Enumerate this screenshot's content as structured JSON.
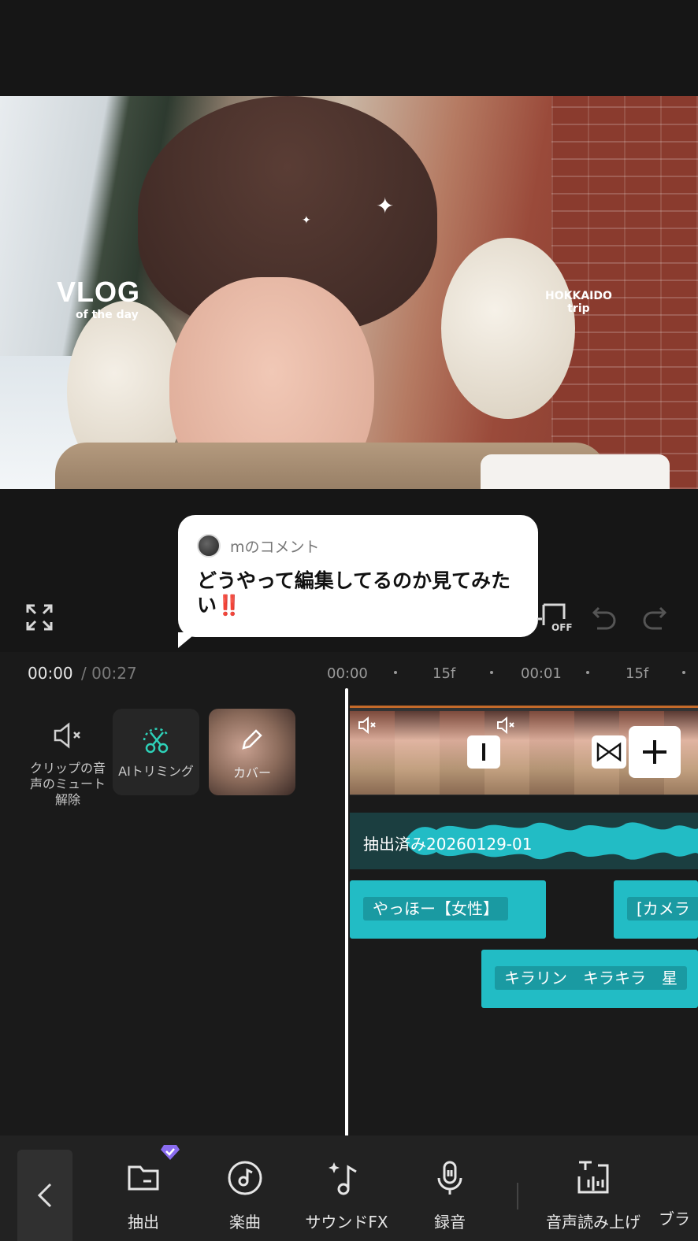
{
  "preview": {
    "overlay_title": "VLOG",
    "overlay_subtitle": "of the day",
    "location_line1": "HOKKAIDO",
    "location_line2": "trip"
  },
  "comment": {
    "author": "mのコメント",
    "text": "どうやって編集してるのか見てみたい",
    "emphasis": "‼️"
  },
  "controls": {
    "fullscreen_icon": "fullscreen-icon",
    "keyframe_icon": "keyframe-off-icon",
    "keyframe_state": "OFF",
    "undo_icon": "undo-icon",
    "redo_icon": "redo-icon"
  },
  "time": {
    "current": "00:00",
    "separator": "/",
    "total": "00:27"
  },
  "ruler": [
    "00:00",
    "15f",
    "00:01",
    "15f"
  ],
  "tools": {
    "mute_label": "クリップの音声のミュート解除",
    "ai_trim_label": "AIトリミング",
    "cover_label": "カバー"
  },
  "tracks": {
    "audio_label": "抽出済み20260129-01",
    "text_clips": [
      "やっほー【女性】",
      "[カメラ",
      "キラリン　キラキラ　星"
    ]
  },
  "bottom_bar": {
    "items": [
      {
        "label": "抽出",
        "icon": "folder-icon"
      },
      {
        "label": "楽曲",
        "icon": "music-disc-icon"
      },
      {
        "label": "サウンドFX",
        "icon": "sound-fx-icon"
      },
      {
        "label": "録音",
        "icon": "microphone-icon"
      },
      {
        "label": "音声読み上げ",
        "icon": "text-to-speech-icon"
      },
      {
        "label": "ブラ",
        "icon": ""
      }
    ]
  },
  "colors": {
    "accent": "#22bcc5",
    "background": "#161616",
    "premium": "#8a6cf0",
    "alert": "#e0181e"
  }
}
